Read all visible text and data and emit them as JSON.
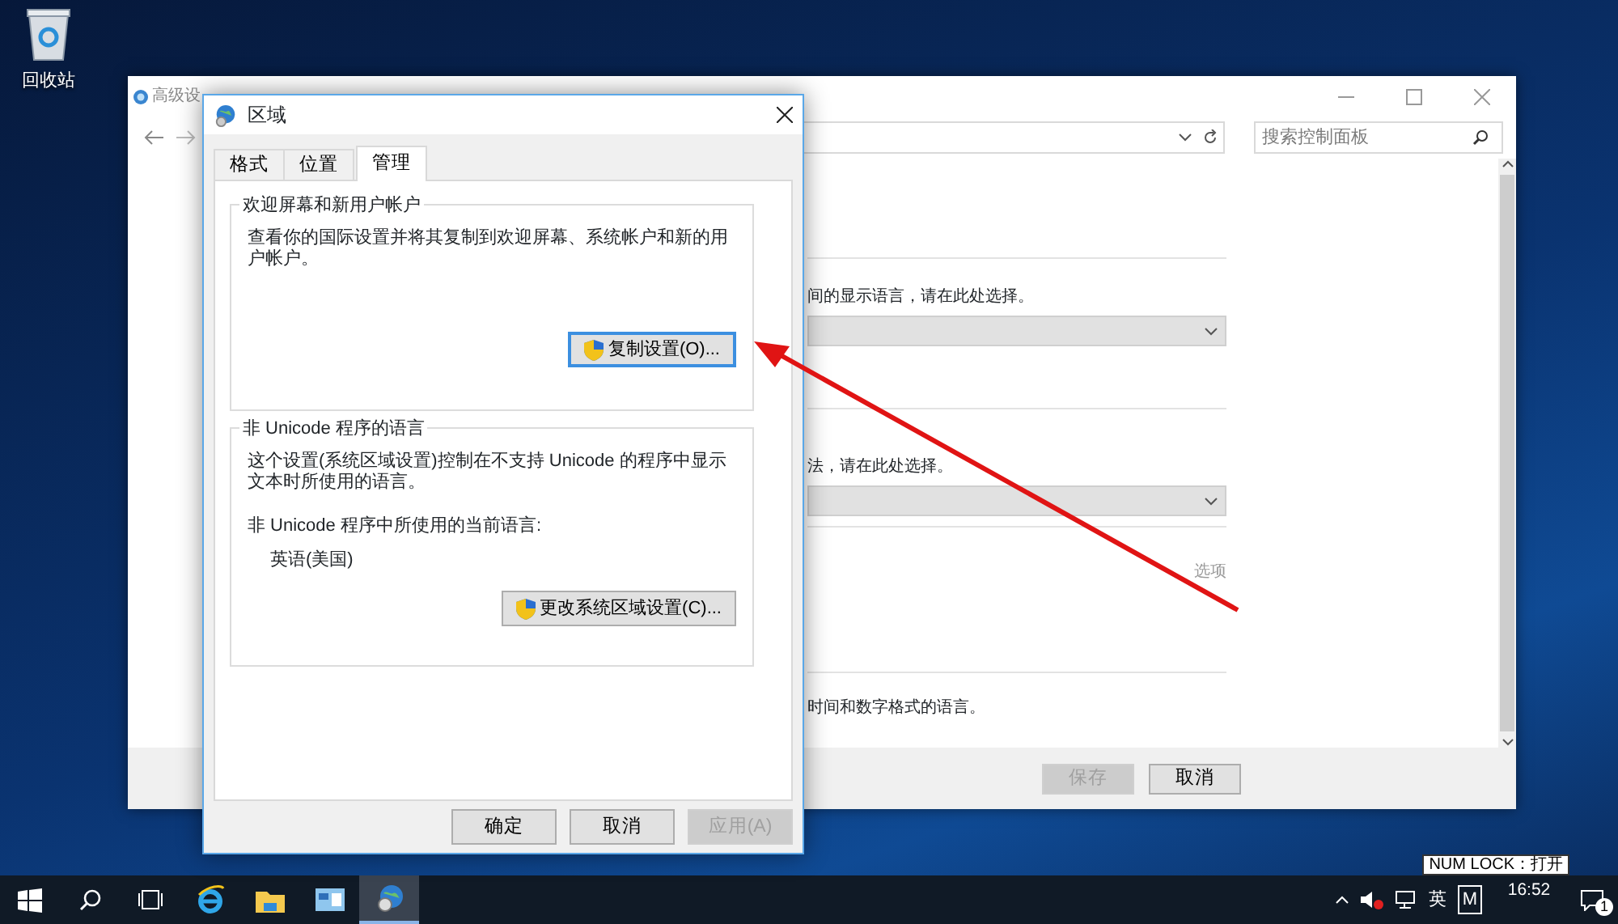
{
  "desktop": {
    "icons": [
      {
        "label": "回收站"
      }
    ]
  },
  "background_window": {
    "title": "高级设",
    "search": {
      "placeholder": "搜索控制面板"
    },
    "sections": [
      {
        "kind": "text-dropdown",
        "text": "间的显示语言，请在此处选择。"
      },
      {
        "kind": "text-dropdown",
        "text": "法，请在此处选择。"
      },
      {
        "kind": "link",
        "text": "选项"
      },
      {
        "kind": "text",
        "text": "时间和数字格式的语言。"
      }
    ],
    "buttons": [
      {
        "label": "保存",
        "disabled": true
      },
      {
        "label": "取消",
        "disabled": false
      }
    ]
  },
  "dialog": {
    "title": "区域",
    "tabs": [
      {
        "label": "格式",
        "selected": false
      },
      {
        "label": "位置",
        "selected": false
      },
      {
        "label": "管理",
        "selected": true
      }
    ],
    "groups": [
      {
        "legend": "欢迎屏幕和新用户帐户",
        "lines": [
          {
            "kind": "paragraph",
            "text": "查看你的国际设置并将其复制到欢迎屏幕、系统帐户和新的用户帐户。"
          }
        ],
        "button": {
          "label": "复制设置(O)...",
          "focused": true
        }
      },
      {
        "legend": "非 Unicode 程序的语言",
        "lines": [
          {
            "kind": "paragraph",
            "text": "这个设置(系统区域设置)控制在不支持 Unicode 的程序中显示文本时所使用的语言。"
          },
          {
            "kind": "label",
            "text": "非 Unicode 程序中所使用的当前语言:"
          },
          {
            "kind": "value",
            "text": "英语(美国)"
          }
        ],
        "button": {
          "label": "更改系统区域设置(C)...",
          "focused": false
        }
      }
    ],
    "buttons": [
      {
        "label": "确定",
        "disabled": false
      },
      {
        "label": "取消",
        "disabled": false
      },
      {
        "label": "应用(A)",
        "disabled": true
      }
    ]
  },
  "taskbar": {
    "apps": [
      {
        "kind": "start",
        "selected": false
      },
      {
        "kind": "search",
        "selected": false
      },
      {
        "kind": "taskview",
        "selected": false
      },
      {
        "kind": "browser",
        "selected": false
      },
      {
        "kind": "folder",
        "selected": false
      },
      {
        "kind": "panel",
        "selected": false
      },
      {
        "kind": "globe",
        "selected": true
      }
    ],
    "input_language": "英",
    "ime_mode": "M",
    "time": "16:52",
    "notification_count": "1"
  },
  "tooltip": {
    "text": "NUM LOCK：打开"
  }
}
